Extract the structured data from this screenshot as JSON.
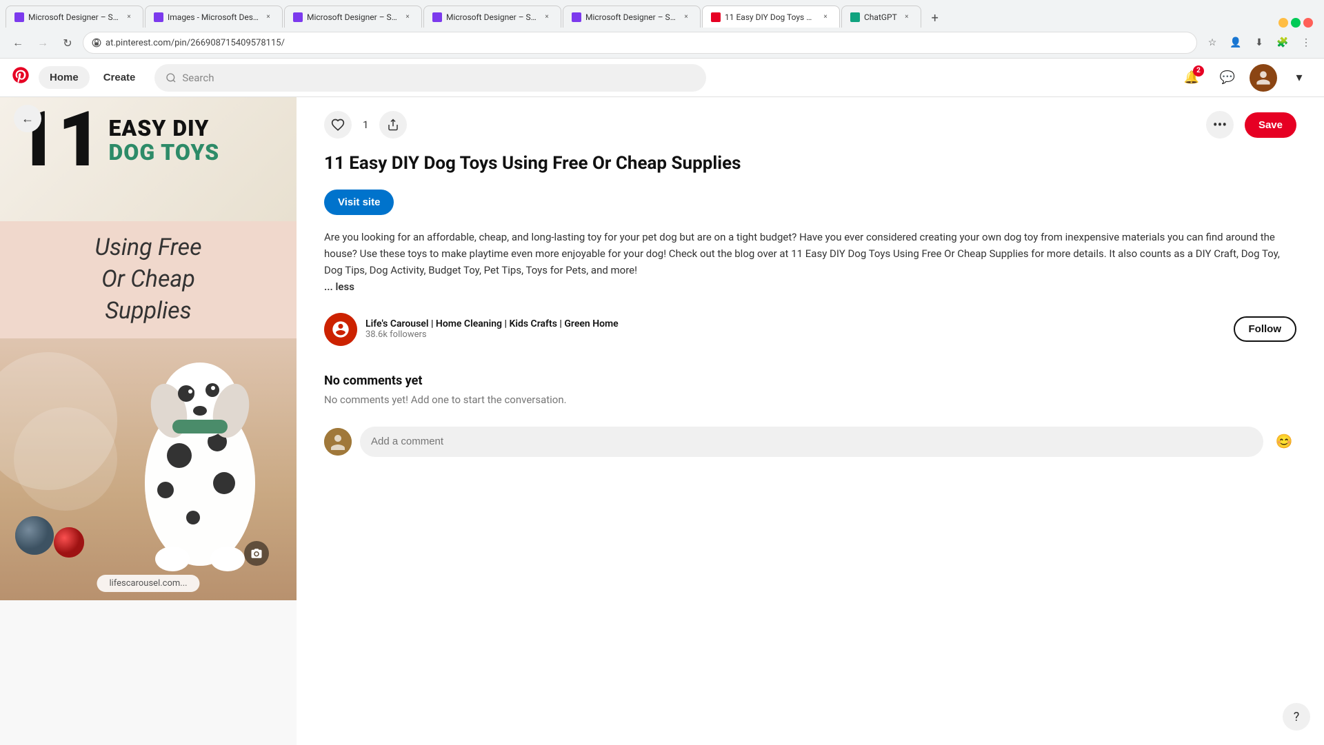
{
  "browser": {
    "tabs": [
      {
        "id": "tab1",
        "favicon_color": "#7c3aed",
        "label": "Microsoft Designer – Stunning...",
        "active": false
      },
      {
        "id": "tab2",
        "favicon_color": "#7c3aed",
        "label": "Images - Microsoft Designer",
        "active": false
      },
      {
        "id": "tab3",
        "favicon_color": "#7c3aed",
        "label": "Microsoft Designer – Stunning...",
        "active": false
      },
      {
        "id": "tab4",
        "favicon_color": "#7c3aed",
        "label": "Microsoft Designer – Stunning...",
        "active": false
      },
      {
        "id": "tab5",
        "favicon_color": "#7c3aed",
        "label": "Microsoft Designer – Stunning...",
        "active": false
      },
      {
        "id": "tab6",
        "favicon_color": "#e60023",
        "label": "11 Easy DIY Dog Toys Using Fr...",
        "active": true
      },
      {
        "id": "tab7",
        "favicon_color": "#10a37f",
        "label": "ChatGPT",
        "active": false
      }
    ],
    "url": "at.pinterest.com/pin/266908715409578115/",
    "nav": {
      "back_disabled": false,
      "forward_disabled": true
    }
  },
  "header": {
    "logo": "P",
    "nav_items": [
      "Home",
      "Create"
    ],
    "search_placeholder": "Search",
    "notification_badge": "2"
  },
  "pin": {
    "image_top_number": "11",
    "image_subtitle": "EASY DIY\nDOG TOYS",
    "image_caption": "Using Free\nOr Cheap\nSupplies",
    "website": "lifescarousel.com...",
    "like_count": "1",
    "title": "11 Easy DIY Dog Toys Using Free Or Cheap Supplies",
    "visit_site_label": "Visit site",
    "save_label": "Save",
    "description": "Are you looking for an affordable, cheap, and long-lasting toy for your pet dog but are on a tight budget? Have you ever considered creating your own dog toy from inexpensive materials you can find around the house? Use these toys to make playtime even more enjoyable for your dog! Check out the blog over at 11 Easy DIY Dog Toys Using Free Or Cheap Supplies for more details. It also counts as a DIY Craft, Dog Toy, Dog Tips, Dog Activity, Budget Toy, Pet Tips, Toys for Pets, and more!",
    "less_label": "... less",
    "author": {
      "name": "Life's Carousel | Home Cleaning | Kids Crafts | Green Home",
      "followers": "38.6k followers",
      "follow_label": "Follow"
    },
    "comments": {
      "title": "No comments yet",
      "subtitle": "No comments yet! Add one to start the conversation.",
      "input_placeholder": "Add a comment"
    }
  }
}
